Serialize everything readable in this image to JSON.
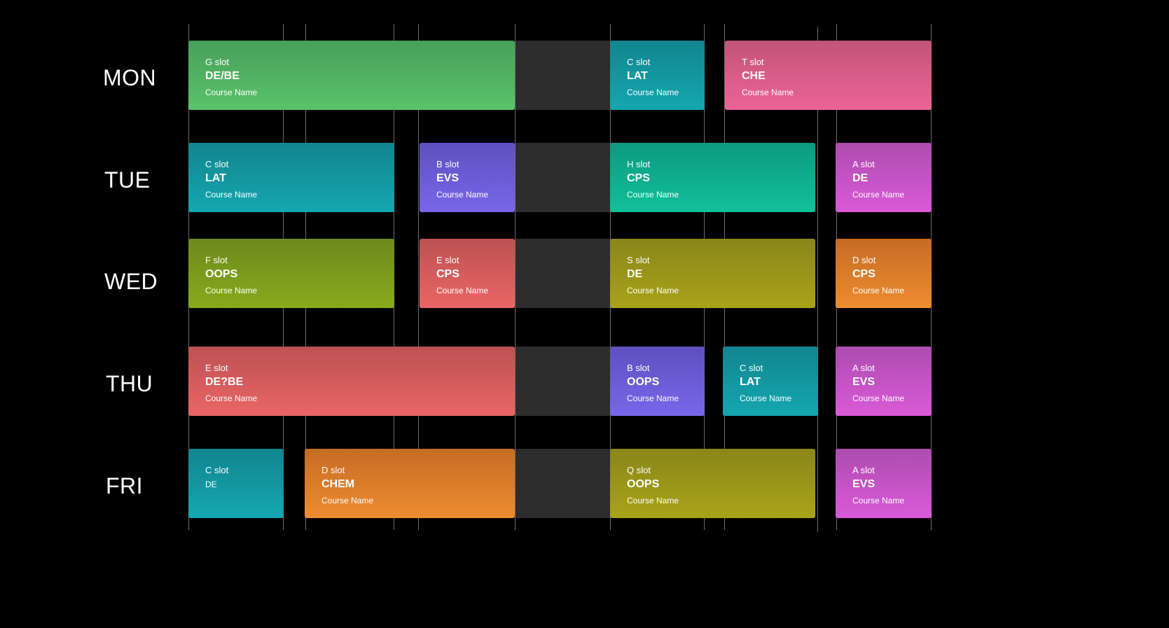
{
  "days": [
    "MON",
    "TUE",
    "WED",
    "THU",
    "FRI"
  ],
  "schedule": {
    "mon": [
      {
        "slot": "G slot",
        "code": "DE/BE",
        "name": "Course Name"
      },
      {
        "slot": "C slot",
        "code": "LAT",
        "name": "Course Name"
      },
      {
        "slot": "T slot",
        "code": "CHE",
        "name": "Course Name"
      }
    ],
    "tue": [
      {
        "slot": "C slot",
        "code": "LAT",
        "name": "Course Name"
      },
      {
        "slot": "B slot",
        "code": "EVS",
        "name": "Course Name"
      },
      {
        "slot": "H slot",
        "code": "CPS",
        "name": "Course Name"
      },
      {
        "slot": "A slot",
        "code": "DE",
        "name": "Course Name"
      }
    ],
    "wed": [
      {
        "slot": "F slot",
        "code": "OOPS",
        "name": "Course Name"
      },
      {
        "slot": "E slot",
        "code": "CPS",
        "name": "Course Name"
      },
      {
        "slot": "S slot",
        "code": "DE",
        "name": "Course Name"
      },
      {
        "slot": "D slot",
        "code": "CPS",
        "name": "Course Name"
      }
    ],
    "thu": [
      {
        "slot": "E slot",
        "code": "DE?BE",
        "name": "Course Name"
      },
      {
        "slot": "B slot",
        "code": "OOPS",
        "name": "Course Name"
      },
      {
        "slot": "C slot",
        "code": "LAT",
        "name": "Course Name"
      },
      {
        "slot": "A slot",
        "code": "EVS",
        "name": "Course Name"
      }
    ],
    "fri": [
      {
        "slot": "C slot",
        "code": "DE"
      },
      {
        "slot": "D slot",
        "code": "CHEM",
        "name": "Course Name"
      },
      {
        "slot": "Q slot",
        "code": "OOPS",
        "name": "Course Name"
      },
      {
        "slot": "A slot",
        "code": "EVS",
        "name": "Course Name"
      }
    ]
  },
  "colors": {
    "background": "#000000",
    "gridline": "#6d6d6d",
    "break": "#2d2d2d",
    "green": "#5bc26a",
    "teal": "#14a7b0",
    "pink": "#ec6497",
    "purple": "#7a66ea",
    "emerald": "#10c09a",
    "magenta": "#d95ad8",
    "lime": "#87aa1d",
    "red": "#ea6666",
    "olive": "#a9a318",
    "orange": "#ee8c30"
  }
}
